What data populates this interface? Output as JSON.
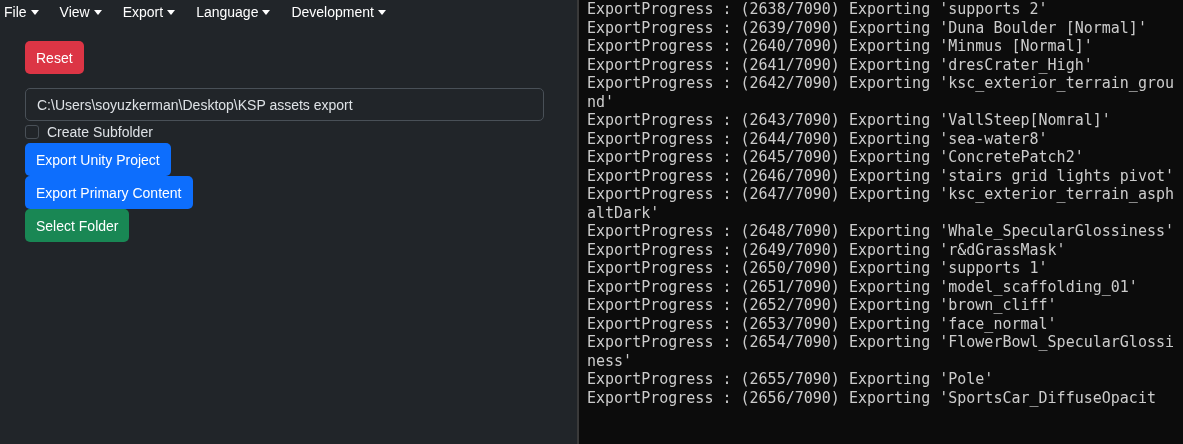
{
  "menu": [
    {
      "label": "File"
    },
    {
      "label": "View"
    },
    {
      "label": "Export"
    },
    {
      "label": "Language"
    },
    {
      "label": "Development"
    }
  ],
  "reset_button": "Reset",
  "path_field": {
    "value": "C:\\Users\\soyuzkerman\\Desktop\\KSP assets export"
  },
  "subfolder_checkbox": {
    "label": "Create Subfolder",
    "checked": false
  },
  "actions": [
    {
      "label": "Export Unity Project",
      "kind": "primary"
    },
    {
      "label": "Export Primary Content",
      "kind": "primary"
    },
    {
      "label": "Select Folder",
      "kind": "success"
    }
  ],
  "console": {
    "lines": [
      "ExportProgress : (2638/7090) Exporting 'supports 2'",
      "ExportProgress : (2639/7090) Exporting 'Duna Boulder [Normal]'",
      "ExportProgress : (2640/7090) Exporting 'Minmus [Normal]'",
      "ExportProgress : (2641/7090) Exporting 'dresCrater_High'",
      "ExportProgress : (2642/7090) Exporting 'ksc_exterior_terrain_ground'",
      "ExportProgress : (2643/7090) Exporting 'VallSteep[Nomral]'",
      "ExportProgress : (2644/7090) Exporting 'sea-water8'",
      "ExportProgress : (2645/7090) Exporting 'ConcretePatch2'",
      "ExportProgress : (2646/7090) Exporting 'stairs grid lights pivot'",
      "ExportProgress : (2647/7090) Exporting 'ksc_exterior_terrain_asphaltDark'",
      "ExportProgress : (2648/7090) Exporting 'Whale_SpecularGlossiness'",
      "ExportProgress : (2649/7090) Exporting 'r&dGrassMask'",
      "ExportProgress : (2650/7090) Exporting 'supports 1'",
      "ExportProgress : (2651/7090) Exporting 'model_scaffolding_01'",
      "ExportProgress : (2652/7090) Exporting 'brown_cliff'",
      "ExportProgress : (2653/7090) Exporting 'face_normal'",
      "ExportProgress : (2654/7090) Exporting 'FlowerBowl_SpecularGlossiness'",
      "ExportProgress : (2655/7090) Exporting 'Pole'",
      "ExportProgress : (2656/7090) Exporting 'SportsCar_DiffuseOpacit"
    ]
  }
}
